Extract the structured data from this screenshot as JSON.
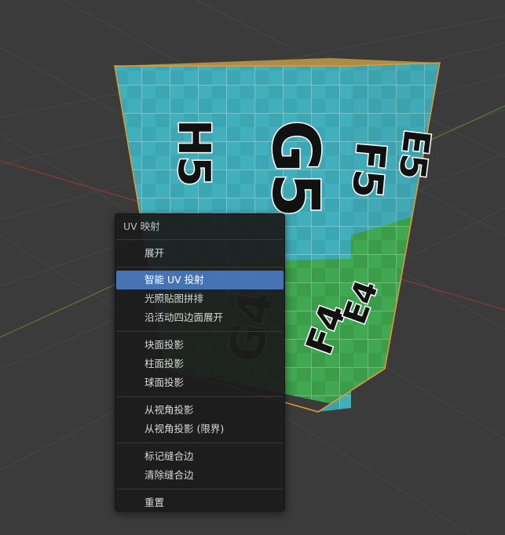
{
  "viewport": {
    "face_labels": [
      "H5",
      "G5",
      "F5",
      "E5",
      "G4",
      "F4",
      "E4"
    ],
    "colors": {
      "background": "#3b3b3b",
      "grid_line": "#474747",
      "x_axis": "#8b3a3a",
      "y_axis": "#5d7a2e",
      "face_cyan": "#3ca7b3",
      "face_green": "#3b9c4a"
    }
  },
  "menu": {
    "title": "UV 映射",
    "groups": [
      {
        "items": [
          {
            "label": "展开",
            "active": false
          }
        ]
      },
      {
        "items": [
          {
            "label": "智能 UV 投射",
            "active": true
          },
          {
            "label": "光照贴图拼排",
            "active": false
          },
          {
            "label": "沿活动四边面展开",
            "active": false
          }
        ]
      },
      {
        "items": [
          {
            "label": "块面投影",
            "active": false
          },
          {
            "label": "柱面投影",
            "active": false
          },
          {
            "label": "球面投影",
            "active": false
          }
        ]
      },
      {
        "items": [
          {
            "label": "从视角投影",
            "active": false
          },
          {
            "label": "从视角投影 (限界)",
            "active": false
          }
        ]
      },
      {
        "items": [
          {
            "label": "标记缝合边",
            "active": false
          },
          {
            "label": "清除缝合边",
            "active": false
          }
        ]
      },
      {
        "items": [
          {
            "label": "重置",
            "active": false
          }
        ]
      }
    ],
    "colors": {
      "background": "#1c1c1c",
      "highlight": "#4772b3",
      "text": "#d9d9d9"
    }
  }
}
